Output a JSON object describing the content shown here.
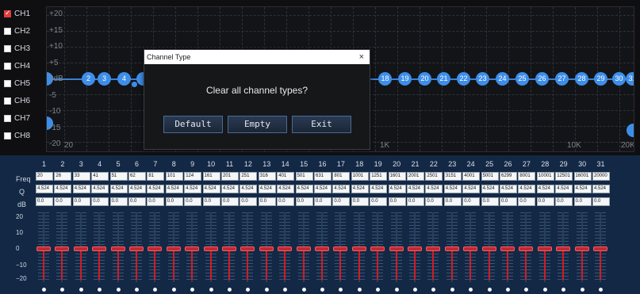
{
  "channels": [
    {
      "label": "CH1",
      "checked": true
    },
    {
      "label": "CH2",
      "checked": false
    },
    {
      "label": "CH3",
      "checked": false
    },
    {
      "label": "CH4",
      "checked": false
    },
    {
      "label": "CH5",
      "checked": false
    },
    {
      "label": "CH6",
      "checked": false
    },
    {
      "label": "CH7",
      "checked": false
    },
    {
      "label": "CH8",
      "checked": false
    }
  ],
  "graph": {
    "y_labels": [
      "+20",
      "+15",
      "+10",
      "+5",
      "0dB",
      "-5",
      "-10",
      "-15",
      "-20"
    ],
    "x_labels": [
      "20",
      "1K",
      "10K",
      "20K"
    ]
  },
  "dialog": {
    "title": "Channel Type",
    "close": "×",
    "message": "Clear all channel types?",
    "buttons": [
      "Default",
      "Empty",
      "Exit"
    ]
  },
  "eq": {
    "labels": {
      "freq": "Freq",
      "q": "Q",
      "db": "dB"
    },
    "db_scale": [
      "20",
      "10",
      "0",
      "−10",
      "−20"
    ],
    "bands": [
      "1",
      "2",
      "3",
      "4",
      "5",
      "6",
      "7",
      "8",
      "9",
      "10",
      "11",
      "12",
      "13",
      "14",
      "15",
      "16",
      "17",
      "18",
      "19",
      "20",
      "21",
      "22",
      "23",
      "24",
      "25",
      "26",
      "27",
      "28",
      "29",
      "30",
      "31"
    ],
    "freq": [
      "20",
      "26",
      "33",
      "41",
      "51",
      "62",
      "81",
      "101",
      "124",
      "161",
      "201",
      "251",
      "316",
      "401",
      "501",
      "631",
      "801",
      "1001",
      "1251",
      "1601",
      "2001",
      "2501",
      "3151",
      "4001",
      "5001",
      "6299",
      "8001",
      "10001",
      "12501",
      "16001",
      "20000"
    ],
    "q": [
      "4.524",
      "4.524",
      "4.524",
      "4.524",
      "4.524",
      "4.524",
      "4.524",
      "4.524",
      "4.524",
      "4.524",
      "4.524",
      "4.524",
      "4.524",
      "4.524",
      "4.524",
      "4.524",
      "4.524",
      "4.524",
      "4.524",
      "4.524",
      "4.524",
      "4.524",
      "4.524",
      "4.524",
      "4.524",
      "4.524",
      "4.524",
      "4.524",
      "4.524",
      "4.524",
      "4.524"
    ],
    "db": [
      "0.0",
      "0.0",
      "0.0",
      "0.0",
      "0.0",
      "0.0",
      "0.0",
      "0.0",
      "0.0",
      "0.0",
      "0.0",
      "0.0",
      "0.0",
      "0.0",
      "0.0",
      "0.0",
      "0.0",
      "0.0",
      "0.0",
      "0.0",
      "0.0",
      "0.0",
      "0.0",
      "0.0",
      "0.0",
      "0.0",
      "0.0",
      "0.0",
      "0.0",
      "0.0",
      "0.0"
    ]
  },
  "colors": {
    "accent": "#3e8ee8",
    "slider_active": "#d21b25",
    "panel_bg": "#132845"
  }
}
